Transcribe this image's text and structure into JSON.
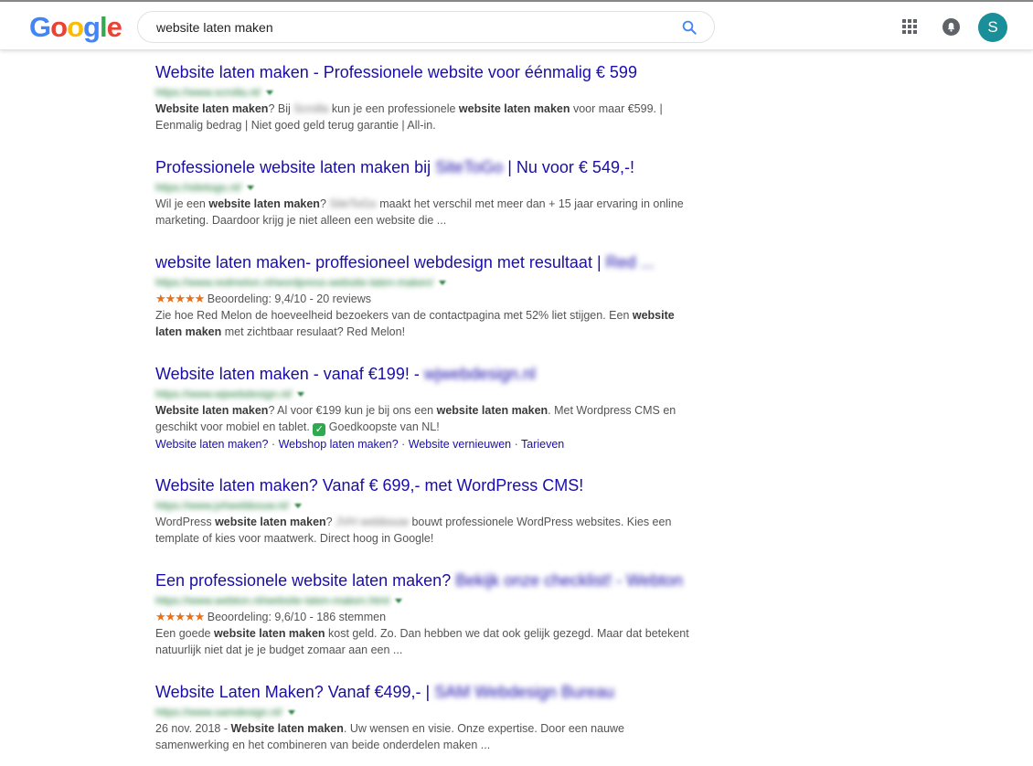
{
  "header": {
    "logo_letters": [
      "G",
      "o",
      "o",
      "g",
      "l",
      "e"
    ],
    "search_value": "website laten maken",
    "avatar_letter": "S"
  },
  "results": [
    {
      "title": "Website laten maken - Professionele website voor éénmalig € 599",
      "url": "https://www.scrolla.nl/",
      "snippet": [
        {
          "b": "Website laten maken"
        },
        {
          "t": "? Bij "
        },
        {
          "blur": "Scrolla"
        },
        {
          "t": " kun je een professionele "
        },
        {
          "b": "website laten maken"
        },
        {
          "t": " voor maar €599. | Eenmalig bedrag | Niet goed geld terug garantie | All-in."
        }
      ]
    },
    {
      "title_start": "Professionele website laten maken bij ",
      "title_blur": "SiteToGo",
      "title_end": " | Nu voor € 549,-!",
      "url": "https://sitetogo.nl/",
      "snippet": [
        {
          "t": "Wil je een "
        },
        {
          "b": "website laten maken"
        },
        {
          "t": "? "
        },
        {
          "blur": "SiteToGo"
        },
        {
          "t": " maakt het verschil met meer dan + 15 jaar ervaring in online marketing. Daardoor krijg je niet alleen een website die ..."
        }
      ]
    },
    {
      "title_start": "website laten maken- proffesioneel webdesign met resultaat | ",
      "title_blur": "Red ...",
      "url": "https://www.redmelon.nl/wordpress-website-laten-maken/",
      "stars": "★★★★★",
      "rating": "Beoordeling: 9,4/10 - 20 reviews",
      "snippet": [
        {
          "t": "Zie hoe Red Melon de hoeveelheid bezoekers van de contactpagina met 52% liet stijgen. Een "
        },
        {
          "b": "website laten maken"
        },
        {
          "t": " met zichtbaar resulaat? Red Melon!"
        }
      ]
    },
    {
      "title_start": "Website laten maken - vanaf €199! - ",
      "title_blur": "wjwebdesign.nl",
      "url": "https://www.wjwebdesign.nl/",
      "snippet": [
        {
          "b": "Website laten maken"
        },
        {
          "t": "? Al voor €199 kun je bij ons een "
        },
        {
          "b": "website laten maken"
        },
        {
          "t": ". Met Wordpress CMS en geschikt voor mobiel en tablet. "
        },
        {
          "check": "✓"
        },
        {
          "t": " Goedkoopste van NL!"
        }
      ],
      "sitelinks": [
        "Website laten maken?",
        "Webshop laten maken?",
        "Website vernieuwen",
        "Tarieven"
      ]
    },
    {
      "title": "Website laten maken? Vanaf € 699,- met WordPress CMS!",
      "url": "https://www.jvhwebbouw.nl/",
      "snippet": [
        {
          "t": "WordPress "
        },
        {
          "b": "website laten maken"
        },
        {
          "t": "? "
        },
        {
          "blur": "JVH webbouw"
        },
        {
          "t": " bouwt professionele WordPress websites. Kies een template of kies voor maatwerk. Direct hoog in Google!"
        }
      ]
    },
    {
      "title_start": "Een professionele website laten maken? ",
      "title_blur": "Bekijk onze checklist! - Webton",
      "url": "https://www.webton.nl/website-laten-maken.html",
      "stars": "★★★★★",
      "rating": "Beoordeling: 9,6/10 - 186 stemmen",
      "snippet": [
        {
          "t": "Een goede "
        },
        {
          "b": "website laten maken"
        },
        {
          "t": " kost geld. Zo. Dan hebben we dat ook gelijk gezegd. Maar dat betekent natuurlijk niet dat je je budget zomaar aan een ..."
        }
      ]
    },
    {
      "title_start": "Website Laten Maken? Vanaf €499,- | ",
      "title_blur": "SAM Webdesign Bureau",
      "url": "https://www.samdesign.nl/",
      "snippet": [
        {
          "t": "26 nov. 2018 - "
        },
        {
          "b": "Website laten maken"
        },
        {
          "t": ". Uw wensen en visie. Onze expertise. Door een nauwe samenwerking en het combineren van beide onderdelen maken ..."
        }
      ]
    }
  ],
  "colors": {
    "title": "#1a0dab",
    "url": "#1d7a35",
    "snippet": "#545454",
    "stars": "#e7711b",
    "avatar": "#1a8f9a"
  }
}
